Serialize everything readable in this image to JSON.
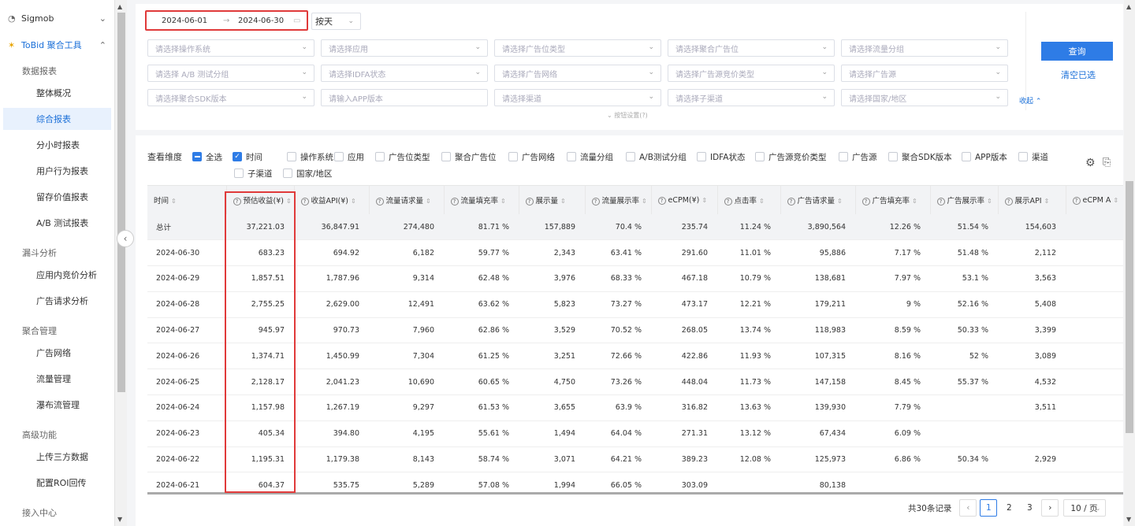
{
  "sidebar": {
    "top": [
      {
        "label": "Sigmob",
        "icon": "sigmob-logo-icon",
        "chevron": "⌄"
      },
      {
        "label": "ToBid 聚合工具",
        "icon": "tobid-logo-icon",
        "chevron": "⌃"
      }
    ],
    "groups": [
      {
        "title": "数据报表",
        "items": [
          "整体概况",
          "综合报表",
          "分小时报表",
          "用户行为报表",
          "留存价值报表",
          "A/B 测试报表"
        ]
      },
      {
        "title": "漏斗分析",
        "items": [
          "应用内竞价分析",
          "广告请求分析"
        ]
      },
      {
        "title": "聚合管理",
        "items": [
          "广告网络",
          "流量管理",
          "瀑布流管理"
        ]
      },
      {
        "title": "高级功能",
        "items": [
          "上传三方数据",
          "配置ROI回传"
        ]
      },
      {
        "title": "接入中心",
        "items": []
      }
    ],
    "active_item": "综合报表"
  },
  "filters": {
    "date_start": "2024-06-01",
    "date_end": "2024-06-30",
    "granularity": "按天",
    "selects": [
      "请选择操作系统",
      "请选择应用",
      "请选择广告位类型",
      "请选择聚合广告位",
      "请选择流量分组",
      "请选择 A/B 测试分组",
      "请选择IDFA状态",
      "请选择广告网络",
      "请选择广告源竞价类型",
      "请选择广告源",
      "请选择聚合SDK版本",
      "请输入APP版本",
      "请选择渠道",
      "请选择子渠道",
      "请选择国家/地区"
    ],
    "query_label": "查询",
    "clear_label": "清空已选",
    "collapse_label": "收起 ⌃",
    "hint": "⌄ 按钮设置(?)"
  },
  "dimensions": {
    "label": "查看维度",
    "options": [
      {
        "label": "全选",
        "state": "partial"
      },
      {
        "label": "时间",
        "state": "checked"
      },
      {
        "label": "操作系统",
        "state": "unchecked"
      },
      {
        "label": "应用",
        "state": "unchecked"
      },
      {
        "label": "广告位类型",
        "state": "unchecked"
      },
      {
        "label": "聚合广告位",
        "state": "unchecked"
      },
      {
        "label": "广告网络",
        "state": "unchecked"
      },
      {
        "label": "流量分组",
        "state": "unchecked"
      },
      {
        "label": "A/B测试分组",
        "state": "unchecked"
      },
      {
        "label": "IDFA状态",
        "state": "unchecked"
      },
      {
        "label": "广告源竞价类型",
        "state": "unchecked"
      },
      {
        "label": "广告源",
        "state": "unchecked"
      },
      {
        "label": "聚合SDK版本",
        "state": "unchecked"
      },
      {
        "label": "APP版本",
        "state": "unchecked"
      },
      {
        "label": "渠道",
        "state": "unchecked"
      },
      {
        "label": "子渠道",
        "state": "unchecked"
      },
      {
        "label": "国家/地区",
        "state": "unchecked"
      }
    ]
  },
  "table": {
    "columns": [
      {
        "label": "时间",
        "help": false
      },
      {
        "label": "预估收益(¥)",
        "help": true
      },
      {
        "label": "收益API(¥)",
        "help": true
      },
      {
        "label": "流量请求量",
        "help": true
      },
      {
        "label": "流量填充率",
        "help": true
      },
      {
        "label": "展示量",
        "help": true
      },
      {
        "label": "流量展示率",
        "help": true
      },
      {
        "label": "eCPM(¥)",
        "help": true
      },
      {
        "label": "点击率",
        "help": true
      },
      {
        "label": "广告请求量",
        "help": true
      },
      {
        "label": "广告填充率",
        "help": true
      },
      {
        "label": "广告展示率",
        "help": true
      },
      {
        "label": "展示API",
        "help": true
      },
      {
        "label": "eCPM A",
        "help": true
      }
    ],
    "total": [
      "总计",
      "37,221.03",
      "36,847.91",
      "274,480",
      "81.71 %",
      "157,889",
      "70.4 %",
      "235.74",
      "11.24 %",
      "3,890,564",
      "12.26 %",
      "51.54 %",
      "154,603",
      ""
    ],
    "rows": [
      [
        "2024-06-30",
        "683.23",
        "694.92",
        "6,182",
        "59.77 %",
        "2,343",
        "63.41 %",
        "291.60",
        "11.01 %",
        "95,886",
        "7.17 %",
        "51.48 %",
        "2,112",
        ""
      ],
      [
        "2024-06-29",
        "1,857.51",
        "1,787.96",
        "9,314",
        "62.48 %",
        "3,976",
        "68.33 %",
        "467.18",
        "10.79 %",
        "138,681",
        "7.97 %",
        "53.1 %",
        "3,563",
        ""
      ],
      [
        "2024-06-28",
        "2,755.25",
        "2,629.00",
        "12,491",
        "63.62 %",
        "5,823",
        "73.27 %",
        "473.17",
        "12.21 %",
        "179,211",
        "9 %",
        "52.16 %",
        "5,408",
        ""
      ],
      [
        "2024-06-27",
        "945.97",
        "970.73",
        "7,960",
        "62.86 %",
        "3,529",
        "70.52 %",
        "268.05",
        "13.74 %",
        "118,983",
        "8.59 %",
        "50.33 %",
        "3,399",
        ""
      ],
      [
        "2024-06-26",
        "1,374.71",
        "1,450.99",
        "7,304",
        "61.25 %",
        "3,251",
        "72.66 %",
        "422.86",
        "11.93 %",
        "107,315",
        "8.16 %",
        "52 %",
        "3,089",
        ""
      ],
      [
        "2024-06-25",
        "2,128.17",
        "2,041.23",
        "10,690",
        "60.65 %",
        "4,750",
        "73.26 %",
        "448.04",
        "11.73 %",
        "147,158",
        "8.45 %",
        "55.37 %",
        "4,532",
        ""
      ],
      [
        "2024-06-24",
        "1,157.98",
        "1,267.19",
        "9,297",
        "61.53 %",
        "3,655",
        "63.9 %",
        "316.82",
        "13.63 %",
        "139,930",
        "7.79 %",
        "",
        "3,511",
        ""
      ],
      [
        "2024-06-23",
        "405.34",
        "394.80",
        "4,195",
        "55.61 %",
        "1,494",
        "64.04 %",
        "271.31",
        "13.12 %",
        "67,434",
        "6.09 %",
        "",
        "",
        ""
      ],
      [
        "2024-06-22",
        "1,195.31",
        "1,179.38",
        "8,143",
        "58.74 %",
        "3,071",
        "64.21 %",
        "389.23",
        "12.08 %",
        "125,973",
        "6.86 %",
        "50.34 %",
        "2,929",
        ""
      ],
      [
        "2024-06-21",
        "604.37",
        "535.75",
        "5,289",
        "57.08 %",
        "1,994",
        "66.05 %",
        "303.09",
        "",
        "80,138",
        "",
        "",
        "",
        ""
      ]
    ]
  },
  "pagination": {
    "total_label": "共30条记录",
    "prev": "‹",
    "pages": [
      "1",
      "2",
      "3"
    ],
    "current": "1",
    "next": "›",
    "page_size": "10 / 页"
  },
  "colors": {
    "accent": "#2e7ce6",
    "highlight": "#e03a3a",
    "active_bg": "#e8f1fd"
  }
}
